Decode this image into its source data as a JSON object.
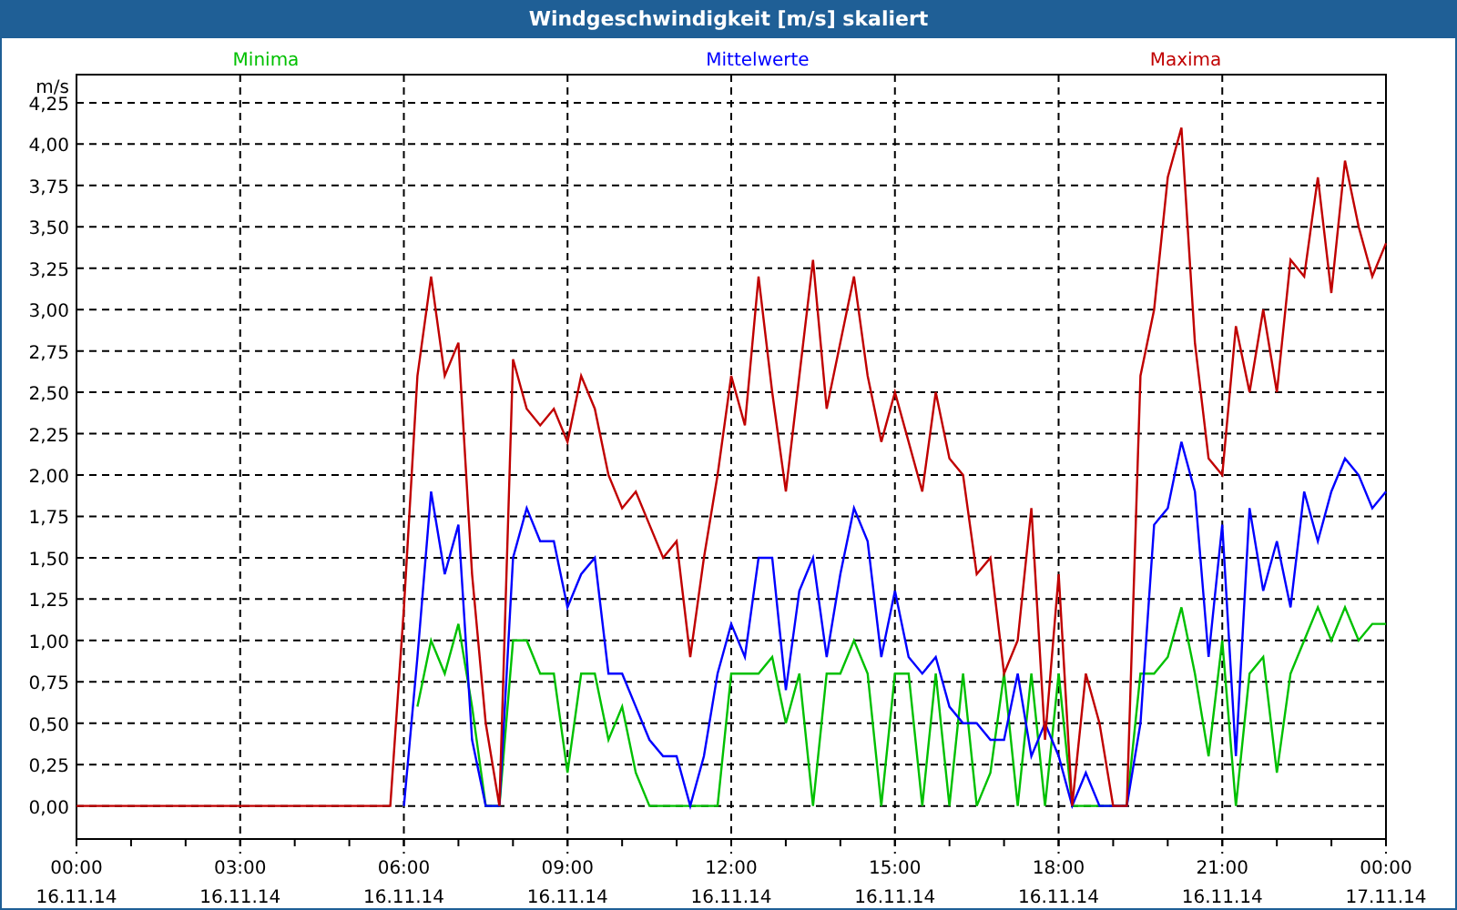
{
  "window": {
    "title": "Windgeschwindigkeit [m/s] skaliert"
  },
  "chart": {
    "chart_data": {
      "type": "line",
      "ylabel": "m/s",
      "x": [
        0,
        0.25,
        0.5,
        0.75,
        1,
        1.25,
        1.5,
        1.75,
        2,
        2.25,
        2.5,
        2.75,
        3,
        3.25,
        3.5,
        3.75,
        4,
        4.25,
        4.5,
        4.75,
        5,
        5.25,
        5.5,
        5.75,
        6,
        6.25,
        6.5,
        6.75,
        7,
        7.25,
        7.5,
        7.75,
        8,
        8.25,
        8.5,
        8.75,
        9,
        9.25,
        9.5,
        9.75,
        10,
        10.25,
        10.5,
        10.75,
        11,
        11.25,
        11.5,
        11.75,
        12,
        12.25,
        12.5,
        12.75,
        13,
        13.25,
        13.5,
        13.75,
        14,
        14.25,
        14.5,
        14.75,
        15,
        15.25,
        15.5,
        15.75,
        16,
        16.25,
        16.5,
        16.75,
        17,
        17.25,
        17.5,
        17.75,
        18,
        18.25,
        18.5,
        18.75,
        19,
        19.25,
        19.5,
        19.75,
        20,
        20.25,
        20.5,
        20.75,
        21,
        21.25,
        21.5,
        21.75,
        22,
        22.25,
        22.5,
        22.75,
        23,
        23.25,
        23.5,
        23.75,
        24
      ],
      "series": [
        {
          "name": "Minima",
          "color": "#00c000",
          "values": [
            null,
            null,
            null,
            null,
            null,
            null,
            null,
            null,
            null,
            null,
            null,
            null,
            null,
            null,
            null,
            null,
            null,
            null,
            null,
            null,
            null,
            null,
            null,
            null,
            null,
            0.6,
            1.0,
            0.8,
            1.1,
            0.6,
            0,
            0,
            1.0,
            1.0,
            0.8,
            0.8,
            0.2,
            0.8,
            0.8,
            0.4,
            0.6,
            0.2,
            0,
            0,
            0,
            0,
            0,
            0,
            0.8,
            0.8,
            0.8,
            0.9,
            0.5,
            0.8,
            0,
            0.8,
            0.8,
            1.0,
            0.8,
            0,
            0.8,
            0.8,
            0,
            0.8,
            0,
            0.8,
            0,
            0.2,
            0.8,
            0,
            0.8,
            0,
            0.8,
            0,
            0,
            0,
            0,
            0,
            0.8,
            0.8,
            0.9,
            1.2,
            0.8,
            0.3,
            1.0,
            0,
            0.8,
            0.9,
            0.2,
            0.8,
            1.0,
            1.2,
            1.0,
            1.2,
            1.0,
            1.1,
            1.1
          ]
        },
        {
          "name": "Mittelwerte",
          "color": "#0000ff",
          "values": [
            null,
            null,
            null,
            null,
            null,
            null,
            null,
            null,
            null,
            null,
            null,
            null,
            null,
            null,
            null,
            null,
            null,
            null,
            null,
            null,
            null,
            null,
            null,
            null,
            0,
            0.9,
            1.9,
            1.4,
            1.7,
            0.4,
            0,
            0,
            1.5,
            1.8,
            1.6,
            1.6,
            1.2,
            1.4,
            1.5,
            0.8,
            0.8,
            0.6,
            0.4,
            0.3,
            0.3,
            0,
            0.3,
            0.8,
            1.1,
            0.9,
            1.5,
            1.5,
            0.7,
            1.3,
            1.5,
            0.9,
            1.4,
            1.8,
            1.6,
            0.9,
            1.3,
            0.9,
            0.8,
            0.9,
            0.6,
            0.5,
            0.5,
            0.4,
            0.4,
            0.8,
            0.3,
            0.5,
            0.3,
            0,
            0.2,
            0,
            0,
            0,
            0.5,
            1.7,
            1.8,
            2.2,
            1.9,
            0.9,
            1.7,
            0.3,
            1.8,
            1.3,
            1.6,
            1.2,
            1.9,
            1.6,
            1.9,
            2.1,
            2.0,
            1.8,
            1.9
          ]
        },
        {
          "name": "Maxima",
          "color": "#c00000",
          "values": [
            0,
            0,
            0,
            0,
            0,
            0,
            0,
            0,
            0,
            0,
            0,
            0,
            0,
            0,
            0,
            0,
            0,
            0,
            0,
            0,
            0,
            0,
            0,
            0,
            1.2,
            2.6,
            3.2,
            2.6,
            2.8,
            1.4,
            0.5,
            0,
            2.7,
            2.4,
            2.3,
            2.4,
            2.2,
            2.6,
            2.4,
            2.0,
            1.8,
            1.9,
            1.7,
            1.5,
            1.6,
            0.9,
            1.5,
            2.0,
            2.6,
            2.3,
            3.2,
            2.5,
            1.9,
            2.6,
            3.3,
            2.4,
            2.8,
            3.2,
            2.6,
            2.2,
            2.5,
            2.2,
            1.9,
            2.5,
            2.1,
            2.0,
            1.4,
            1.5,
            0.8,
            1.0,
            1.8,
            0.4,
            1.4,
            0,
            0.8,
            0.5,
            0,
            0,
            2.6,
            3.0,
            3.8,
            4.1,
            2.8,
            2.1,
            2.0,
            2.9,
            2.5,
            3.0,
            2.5,
            3.3,
            3.2,
            3.8,
            3.1,
            3.9,
            3.5,
            3.2,
            3.4
          ]
        }
      ],
      "grid": true,
      "xlim": [
        0,
        24
      ],
      "ylim": [
        -0.2,
        4.42
      ],
      "xticks": [
        {
          "value": 0,
          "label": "00:00"
        },
        {
          "value": 3,
          "label": "03:00"
        },
        {
          "value": 6,
          "label": "06:00"
        },
        {
          "value": 9,
          "label": "09:00"
        },
        {
          "value": 12,
          "label": "12:00"
        },
        {
          "value": 15,
          "label": "15:00"
        },
        {
          "value": 18,
          "label": "18:00"
        },
        {
          "value": 21,
          "label": "21:00"
        },
        {
          "value": 24,
          "label": "00:00"
        }
      ],
      "yticks": [
        {
          "value": 0,
          "label": "0,00"
        },
        {
          "value": 0.25,
          "label": "0,25"
        },
        {
          "value": 0.5,
          "label": "0,50"
        },
        {
          "value": 0.75,
          "label": "0,75"
        },
        {
          "value": 1,
          "label": "1,00"
        },
        {
          "value": 1.25,
          "label": "1,25"
        },
        {
          "value": 1.5,
          "label": "1,50"
        },
        {
          "value": 1.75,
          "label": "1,75"
        },
        {
          "value": 2,
          "label": "2,00"
        },
        {
          "value": 2.25,
          "label": "2,25"
        },
        {
          "value": 2.5,
          "label": "2,50"
        },
        {
          "value": 2.75,
          "label": "2,75"
        },
        {
          "value": 3,
          "label": "3,00"
        },
        {
          "value": 3.25,
          "label": "3,25"
        },
        {
          "value": 3.5,
          "label": "3,50"
        },
        {
          "value": 3.75,
          "label": "3,75"
        },
        {
          "value": 4,
          "label": "4,00"
        },
        {
          "value": 4.25,
          "label": "4,25"
        }
      ]
    },
    "x_tick_dates": [
      "16.11.14",
      "16.11.14",
      "16.11.14",
      "16.11.14",
      "16.11.14",
      "16.11.14",
      "16.11.14",
      "16.11.14",
      "17.11.14"
    ]
  }
}
